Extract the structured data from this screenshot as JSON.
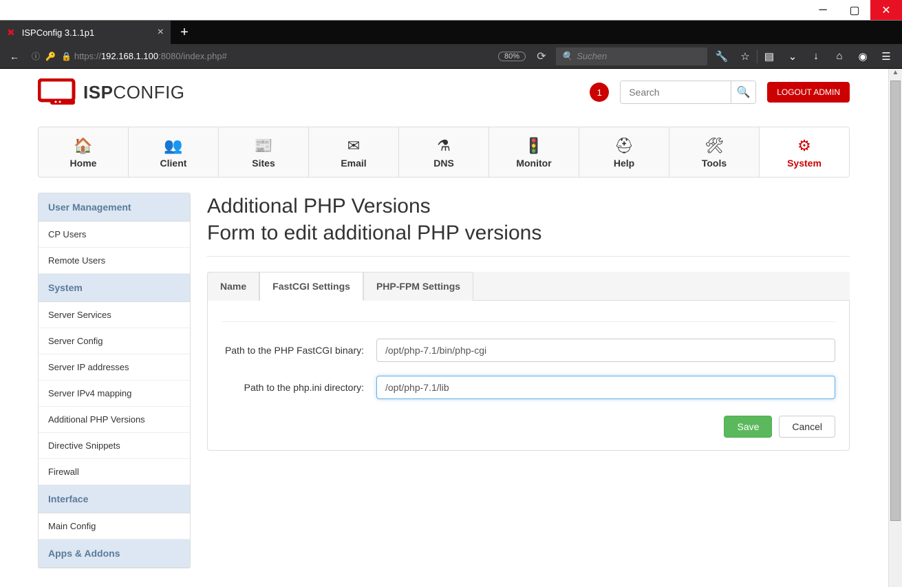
{
  "browser": {
    "tab_title": "ISPConfig 3.1.1p1",
    "url_prefix": "https://",
    "url_host": "192.168.1.100",
    "url_path": ":8080/index.php#",
    "zoom": "80%",
    "find_placeholder": "Suchen"
  },
  "header": {
    "logo_bold": "ISP",
    "logo_light": "CONFIG",
    "badge": "1",
    "search_placeholder": "Search",
    "logout": "LOGOUT ADMIN"
  },
  "nav": {
    "items": [
      {
        "label": "Home",
        "icon": "🏠"
      },
      {
        "label": "Client",
        "icon": "👥"
      },
      {
        "label": "Sites",
        "icon": "📰"
      },
      {
        "label": "Email",
        "icon": "✉"
      },
      {
        "label": "DNS",
        "icon": "⚗"
      },
      {
        "label": "Monitor",
        "icon": "🚦"
      },
      {
        "label": "Help",
        "icon": "⛑"
      },
      {
        "label": "Tools",
        "icon": "🛠"
      },
      {
        "label": "System",
        "icon": "⚙"
      }
    ]
  },
  "sidebar": {
    "g1": "User Management",
    "g1_items": [
      "CP Users",
      "Remote Users"
    ],
    "g2": "System",
    "g2_items": [
      "Server Services",
      "Server Config",
      "Server IP addresses",
      "Server IPv4 mapping",
      "Additional PHP Versions",
      "Directive Snippets",
      "Firewall"
    ],
    "g3": "Interface",
    "g3_items": [
      "Main Config"
    ],
    "g4": "Apps & Addons"
  },
  "page": {
    "title_line1": "Additional PHP Versions",
    "title_line2": "Form to edit additional PHP versions",
    "tabs": [
      "Name",
      "FastCGI Settings",
      "PHP-FPM Settings"
    ],
    "field1_label": "Path to the PHP FastCGI binary:",
    "field1_value": "/opt/php-7.1/bin/php-cgi",
    "field2_label": "Path to the php.ini directory:",
    "field2_value": "/opt/php-7.1/lib",
    "save": "Save",
    "cancel": "Cancel"
  }
}
